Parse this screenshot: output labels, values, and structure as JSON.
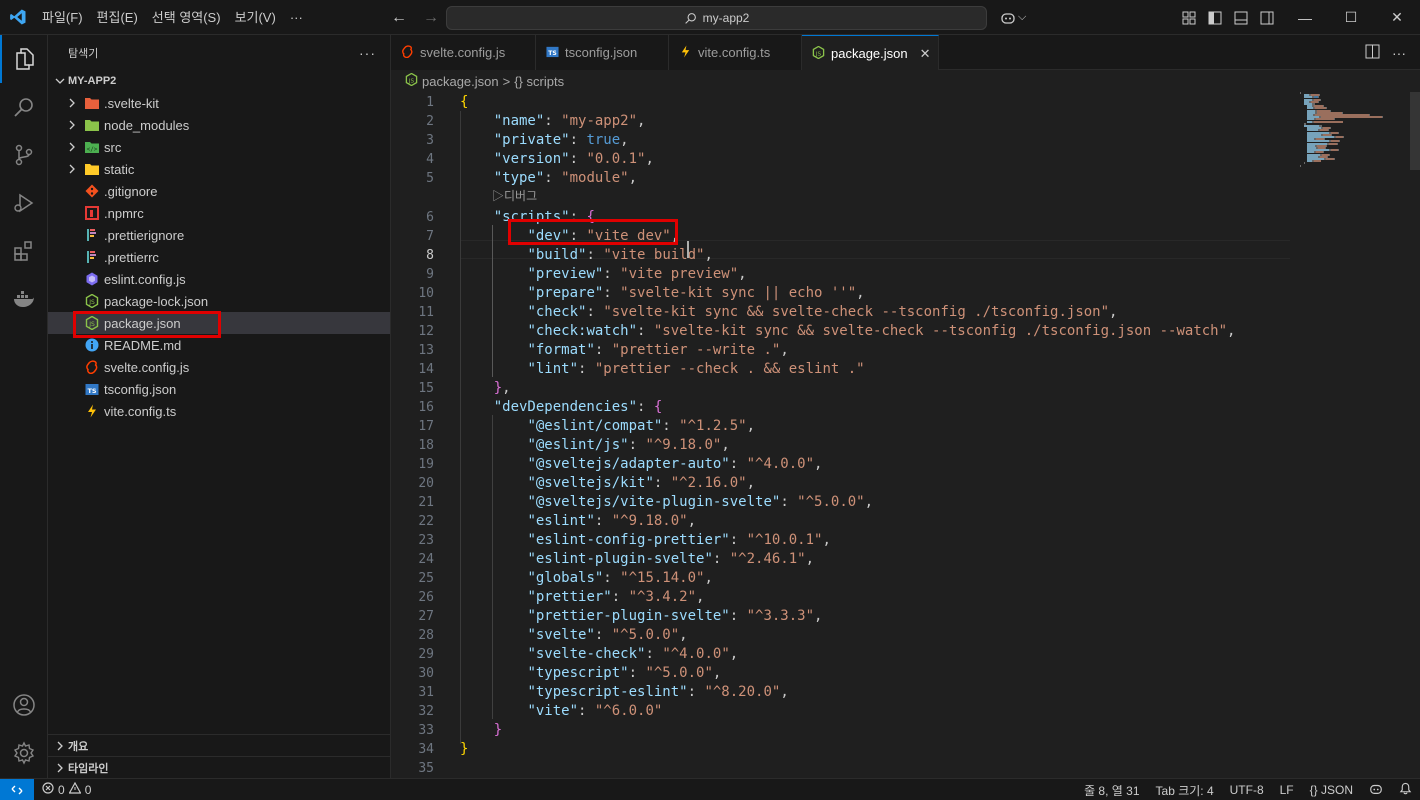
{
  "titlebar": {
    "menus": [
      "파일(F)",
      "편집(E)",
      "선택 영역(S)",
      "보기(V)",
      "···"
    ],
    "search_text": "my-app2"
  },
  "sidebar": {
    "header": "탐색기",
    "more": "···",
    "folder": "MY-APP2",
    "items": [
      {
        "label": ".svelte-kit",
        "type": "folder",
        "icon": "svelte-kit-folder-icon",
        "color": "#e8603c"
      },
      {
        "label": "node_modules",
        "type": "folder",
        "icon": "node-modules-folder-icon",
        "color": "#8bc34a"
      },
      {
        "label": "src",
        "type": "folder",
        "icon": "src-folder-icon",
        "color": "#4caf50"
      },
      {
        "label": "static",
        "type": "folder",
        "icon": "static-folder-icon",
        "color": "#ffca28"
      },
      {
        "label": ".gitignore",
        "type": "file",
        "icon": "git-icon",
        "color": "#f4511e"
      },
      {
        "label": ".npmrc",
        "type": "file",
        "icon": "npm-icon",
        "color": "#e53935"
      },
      {
        "label": ".prettierignore",
        "type": "file",
        "icon": "prettier-icon",
        "color": "#56b3b4"
      },
      {
        "label": ".prettierrc",
        "type": "file",
        "icon": "prettier-icon",
        "color": "#56b3b4"
      },
      {
        "label": "eslint.config.js",
        "type": "file",
        "icon": "eslint-icon",
        "color": "#7c6cf0"
      },
      {
        "label": "package-lock.json",
        "type": "file",
        "icon": "nodejs-icon",
        "color": "#8bc34a"
      },
      {
        "label": "package.json",
        "type": "file",
        "icon": "nodejs-icon",
        "color": "#8bc34a"
      },
      {
        "label": "README.md",
        "type": "file",
        "icon": "info-icon",
        "color": "#42a5f5"
      },
      {
        "label": "svelte.config.js",
        "type": "file",
        "icon": "svelte-icon",
        "color": "#ff3e00"
      },
      {
        "label": "tsconfig.json",
        "type": "file",
        "icon": "tsconfig-icon",
        "color": "#3178c6"
      },
      {
        "label": "vite.config.ts",
        "type": "file",
        "icon": "vite-icon",
        "color": "#ffc107"
      }
    ],
    "bottom_sections": [
      "개요",
      "타임라인"
    ]
  },
  "tabs": [
    {
      "label": "svelte.config.js",
      "icon": "svelte-icon",
      "active": false
    },
    {
      "label": "tsconfig.json",
      "icon": "tsconfig-icon",
      "active": false
    },
    {
      "label": "vite.config.ts",
      "icon": "vite-icon",
      "active": false
    },
    {
      "label": "package.json",
      "icon": "nodejs-icon",
      "active": true
    }
  ],
  "breadcrumb": {
    "file": "package.json",
    "separator": ">",
    "symbol": "{} scripts"
  },
  "editor": {
    "codelens": "▷디버그",
    "current_line": 8,
    "line_numbers": [
      "1",
      "2",
      "3",
      "4",
      "5",
      "6",
      "7",
      "8",
      "9",
      "10",
      "11",
      "12",
      "13",
      "14",
      "15",
      "16",
      "17",
      "18",
      "19",
      "20",
      "21",
      "22",
      "23",
      "24",
      "25",
      "26",
      "27",
      "28",
      "29",
      "30",
      "31",
      "32",
      "33",
      "34",
      "35"
    ],
    "scripts": [
      {
        "key": "\"dev\"",
        "value": "\"vite dev\""
      },
      {
        "key": "\"build\"",
        "value": "\"vite build\""
      },
      {
        "key": "\"preview\"",
        "value": "\"vite preview\""
      },
      {
        "key": "\"prepare\"",
        "value": "\"svelte-kit sync || echo ''\""
      },
      {
        "key": "\"check\"",
        "value": "\"svelte-kit sync && svelte-check --tsconfig ./tsconfig.json\""
      },
      {
        "key": "\"check:watch\"",
        "value": "\"svelte-kit sync && svelte-check --tsconfig ./tsconfig.json --watch\""
      },
      {
        "key": "\"format\"",
        "value": "\"prettier --write .\""
      },
      {
        "key": "\"lint\"",
        "value": "\"prettier --check . && eslint .\""
      }
    ],
    "top_fields": [
      {
        "key": "\"name\"",
        "value": "\"my-app2\"",
        "kind": "string"
      },
      {
        "key": "\"private\"",
        "value": "true",
        "kind": "bool"
      },
      {
        "key": "\"version\"",
        "value": "\"0.0.1\"",
        "kind": "string"
      },
      {
        "key": "\"type\"",
        "value": "\"module\"",
        "kind": "string"
      }
    ],
    "scripts_key": "\"scripts\"",
    "devdeps_key": "\"devDependencies\"",
    "dev_dependencies": [
      {
        "key": "\"@eslint/compat\"",
        "value": "\"^1.2.5\""
      },
      {
        "key": "\"@eslint/js\"",
        "value": "\"^9.18.0\""
      },
      {
        "key": "\"@sveltejs/adapter-auto\"",
        "value": "\"^4.0.0\""
      },
      {
        "key": "\"@sveltejs/kit\"",
        "value": "\"^2.16.0\""
      },
      {
        "key": "\"@sveltejs/vite-plugin-svelte\"",
        "value": "\"^5.0.0\""
      },
      {
        "key": "\"eslint\"",
        "value": "\"^9.18.0\""
      },
      {
        "key": "\"eslint-config-prettier\"",
        "value": "\"^10.0.1\""
      },
      {
        "key": "\"eslint-plugin-svelte\"",
        "value": "\"^2.46.1\""
      },
      {
        "key": "\"globals\"",
        "value": "\"^15.14.0\""
      },
      {
        "key": "\"prettier\"",
        "value": "\"^3.4.2\""
      },
      {
        "key": "\"prettier-plugin-svelte\"",
        "value": "\"^3.3.3\""
      },
      {
        "key": "\"svelte\"",
        "value": "\"^5.0.0\""
      },
      {
        "key": "\"svelte-check\"",
        "value": "\"^4.0.0\""
      },
      {
        "key": "\"typescript\"",
        "value": "\"^5.0.0\""
      },
      {
        "key": "\"typescript-eslint\"",
        "value": "\"^8.20.0\""
      },
      {
        "key": "\"vite\"",
        "value": "\"^6.0.0\""
      }
    ]
  },
  "statusbar": {
    "errors": "0",
    "warnings": "0",
    "position": "줄 8, 열 31",
    "indent": "Tab 크기: 4",
    "encoding": "UTF-8",
    "eol": "LF",
    "language": "{} JSON"
  },
  "colors": {
    "accent": "#0078d4",
    "highlight_box": "#e00000",
    "json_key": "#9cdcfe",
    "json_string": "#ce9178"
  }
}
